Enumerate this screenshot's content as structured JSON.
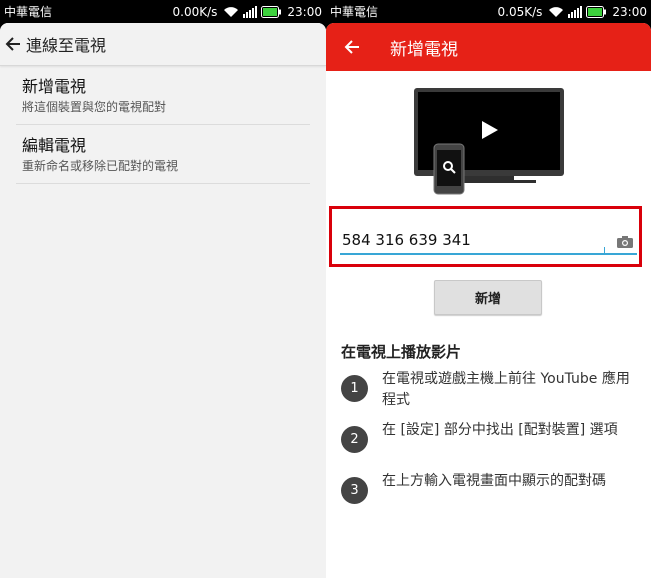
{
  "left_phone": {
    "status": {
      "carrier": "中華電信",
      "speed": "0.00K/s",
      "time": "23:00"
    },
    "appbar": {
      "title": "連線至電視"
    },
    "menu": [
      {
        "title": "新增電視",
        "subtitle": "將這個裝置與您的電視配對"
      },
      {
        "title": "編輯電視",
        "subtitle": "重新命名或移除已配對的電視"
      }
    ]
  },
  "right_phone": {
    "status": {
      "carrier": "中華電信",
      "speed": "0.05K/s",
      "time": "23:00"
    },
    "appbar": {
      "title": "新增電視",
      "color": "#e62117"
    },
    "pair_code_input": {
      "value": "584 316 639 341",
      "placeholder": ""
    },
    "add_button_label": "新增",
    "steps_title": "在電視上播放影片",
    "steps": [
      {
        "number": "1",
        "text": "在電視或遊戲主機上前往 YouTube 應用程式"
      },
      {
        "number": "2",
        "text": "在 [設定] 部分中找出 [配對裝置] 選項"
      },
      {
        "number": "3",
        "text": "在上方輸入電視畫面中顯示的配對碼"
      }
    ]
  },
  "colors": {
    "accent_red": "#e62117",
    "highlight_border": "#d9000a",
    "input_underline": "#38a6d6"
  },
  "icons": [
    "back-arrow-icon",
    "wifi-icon",
    "signal-icon",
    "battery-icon",
    "tv-icon",
    "play-icon",
    "phone-search-icon",
    "camera-icon"
  ]
}
